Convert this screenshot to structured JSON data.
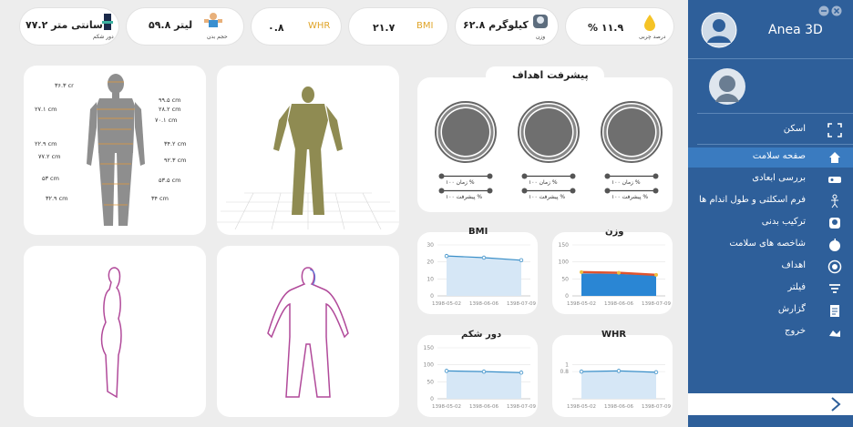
{
  "app": {
    "title": "Anea 3D"
  },
  "stats": [
    {
      "value": "۷۷.۲ سانتی متر",
      "caption": "دور شکم",
      "icon": "waist-figure-icon"
    },
    {
      "value": "۵۹.۸ لیتر",
      "caption": "حجم بدن",
      "icon": "muscle-figure-icon"
    },
    {
      "value": "۰.۸",
      "label": "WHR"
    },
    {
      "value": "۲۱.۷",
      "label": "BMI"
    },
    {
      "value": "۶۲.۸ کیلوگرم",
      "caption": "وزن",
      "icon": "scale-icon"
    },
    {
      "value": "% ۱۱.۹",
      "caption": "درصد چربی",
      "icon": "fat-drop-icon"
    }
  ],
  "measurements": {
    "left": [
      "۳۶.۳ cr",
      "۲۷.۱ cm",
      "۲۲.۹ cm",
      "۷۷.۲ cm",
      "۵۳ cm",
      "۳۲.۹ cm"
    ],
    "right": [
      "۹۹.۵ cm",
      "۲۸.۲ cm",
      "۷۰.۱ cm",
      "۳۴.۲ cm",
      "۹۲.۳ cm",
      "۵۳.۵ cm",
      "۳۴ cm"
    ]
  },
  "goals": {
    "title": "پیشرفت اهداف",
    "items": [
      {
        "time": "زمان ۱۰۰ %",
        "progress": "پیشرفت ۱۰۰ %"
      },
      {
        "time": "زمان ۱۰۰ %",
        "progress": "پیشرفت ۱۰۰ %"
      },
      {
        "time": "زمان ۱۰۰ %",
        "progress": "پیشرفت ۱۰۰ %"
      }
    ]
  },
  "chart_data": [
    {
      "type": "line",
      "title": "BMI",
      "x": [
        "1398-05-02",
        "1398-06-06",
        "1398-07-09"
      ],
      "values": [
        23.5,
        22.5,
        21
      ],
      "ylim": [
        0,
        30
      ],
      "yticks": [
        0,
        10,
        20,
        30
      ]
    },
    {
      "type": "area",
      "title": "وزن",
      "x": [
        "1398-05-02",
        "1398-06-06",
        "1398-07-09"
      ],
      "series": [
        {
          "values": [
            70,
            68,
            62
          ]
        },
        {
          "values": [
            66,
            65,
            60
          ]
        }
      ],
      "ylim": [
        0,
        150
      ],
      "yticks": [
        0,
        50,
        100,
        150
      ]
    },
    {
      "type": "line",
      "title": "دور شکم",
      "x": [
        "1398-05-02",
        "1398-06-06",
        "1398-07-09"
      ],
      "values": [
        82,
        80,
        77
      ],
      "ylim": [
        0,
        150
      ],
      "yticks": [
        0,
        50,
        100,
        150
      ]
    },
    {
      "type": "line",
      "title": "WHR",
      "x": [
        "1398-05-02",
        "1398-06-06",
        "1398-07-09"
      ],
      "values": [
        0.8,
        0.82,
        0.78
      ],
      "ylim": [
        0,
        1.5
      ],
      "yticks": [
        0.8,
        1
      ]
    }
  ],
  "sidebar": {
    "scan": "اسکن",
    "items": [
      {
        "label": "صفحه سلامت",
        "icon": "home-icon",
        "active": true
      },
      {
        "label": "بررسی ابعادی",
        "icon": "body-scan-icon"
      },
      {
        "label": "فرم اسکلتی و طول اندام ها",
        "icon": "skeleton-icon"
      },
      {
        "label": "ترکیب بدنی",
        "icon": "body-composition-icon"
      },
      {
        "label": "شاخصه های سلامت",
        "icon": "apple-icon"
      },
      {
        "label": "اهداف",
        "icon": "target-icon"
      },
      {
        "label": "فیلتر",
        "icon": "filter-icon"
      },
      {
        "label": "گزارش",
        "icon": "report-icon"
      },
      {
        "label": "خروج",
        "icon": "exit-icon"
      }
    ]
  },
  "colors": {
    "sidebar": "#2e5f9a",
    "active": "#3a7bc0",
    "accent": "#e0a428",
    "line": "#3a8fc8",
    "fill": "#cfe3f5"
  }
}
